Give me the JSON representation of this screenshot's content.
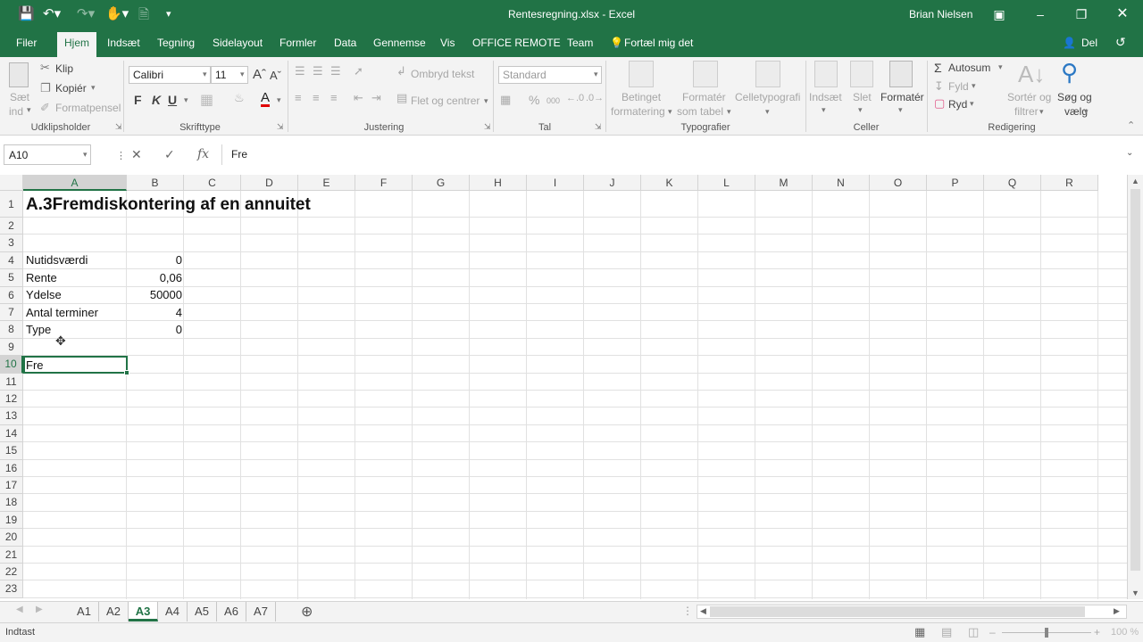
{
  "window": {
    "title": "Rentesregning.xlsx - Excel",
    "user": "Brian Nielsen"
  },
  "menu": {
    "file": "Filer",
    "home": "Hjem",
    "insert": "Indsæt",
    "draw": "Tegning",
    "layout": "Sidelayout",
    "formulas": "Formler",
    "data": "Data",
    "review": "Gennemse",
    "view": "Vis",
    "office_remote": "OFFICE REMOTE",
    "team": "Team",
    "tell": "Fortæl mig det",
    "share": "Del"
  },
  "ribbon": {
    "paste_line1": "Sæt",
    "paste_line2": "ind",
    "cut": "Klip",
    "copy": "Kopiér",
    "format_painter": "Formatpensel",
    "group_clipboard": "Udklipsholder",
    "font_name": "Calibri",
    "font_size": "11",
    "bold": "F",
    "italic": "K",
    "underline": "U",
    "group_font": "Skrifttype",
    "wrap_text": "Ombryd tekst",
    "merge_center": "Flet og centrer",
    "group_alignment": "Justering",
    "number_format": "Standard",
    "percent": "%",
    "thousands": "000",
    "group_number": "Tal",
    "cond_format_1": "Betinget",
    "cond_format_2": "formatering",
    "format_table_1": "Formatér",
    "format_table_2": "som tabel",
    "cell_styles": "Celletypografi",
    "group_styles": "Typografier",
    "insert_cells": "Indsæt",
    "delete_cells": "Slet",
    "format_cells": "Formatér",
    "group_cells": "Celler",
    "autosum": "Autosum",
    "fill": "Fyld",
    "clear": "Ryd",
    "sort_1": "Sortér og",
    "sort_2": "filtrer",
    "find_1": "Søg og",
    "find_2": "vælg",
    "group_editing": "Redigering"
  },
  "formula_bar": {
    "name_box": "A10",
    "formula": "Fre",
    "fx": "fx"
  },
  "columns": [
    "A",
    "B",
    "C",
    "D",
    "E",
    "F",
    "G",
    "H",
    "I",
    "J",
    "K",
    "L",
    "M",
    "N",
    "O",
    "P",
    "Q",
    "R"
  ],
  "rows": [
    "1",
    "2",
    "3",
    "4",
    "5",
    "6",
    "7",
    "8",
    "9",
    "10",
    "11",
    "12",
    "13",
    "14",
    "15",
    "16",
    "17",
    "18",
    "19",
    "20",
    "21",
    "22",
    "23"
  ],
  "cells": {
    "a1": "A.3Fremdiskontering af en annuitet",
    "a4": "Nutidsværdi",
    "b4": "0",
    "a5": "Rente",
    "b5": "0,06",
    "a6": "Ydelse",
    "b6": "50000",
    "a7": "Antal terminer",
    "b7": "4",
    "a8": "Type",
    "b8": "0",
    "a10": "Fre"
  },
  "sheets": [
    "A1",
    "A2",
    "A3",
    "A4",
    "A5",
    "A6",
    "A7"
  ],
  "active_sheet": "A3",
  "status": {
    "mode": "Indtast",
    "zoom": "100 %"
  },
  "colors": {
    "excel_green": "#217346"
  }
}
